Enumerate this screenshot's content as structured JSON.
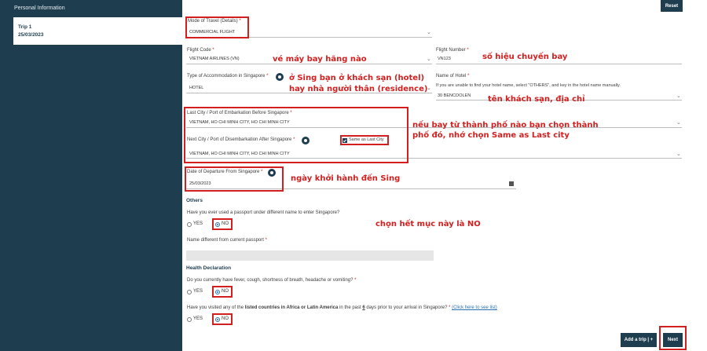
{
  "sidebar": {
    "header": "Personal Information",
    "trip_label": "Trip 1",
    "trip_date": "25/03/2023"
  },
  "toolbar": {
    "reset_label": "Reset"
  },
  "form": {
    "mode_of_travel": {
      "label": "Mode of Travel (Details)",
      "value": "COMMERCIAL FLIGHT"
    },
    "flight_code": {
      "label": "Flight Code",
      "value": "VIETNAM AIRLINES (VN)"
    },
    "flight_number": {
      "label": "Flight Number",
      "value": "VN123"
    },
    "accommodation_type": {
      "label": "Type of Accommodation in Singapore",
      "value": "HOTEL"
    },
    "hotel_name": {
      "label": "Name of Hotel",
      "help": "If you are unable to find your hotel name, select \"OTHERS\", and key in the hotel name manually.",
      "value": "30 BENCOOLEN"
    },
    "last_city": {
      "label": "Last City / Port of Embarkation Before Singapore",
      "value": "VIETNAM, HO CHI MINH CITY, HO CHI MINH CITY"
    },
    "next_city": {
      "label": "Next City / Port of Disembarkation After Singapore",
      "value": "VIETNAM, HO CHI MINH CITY, HO CHI MINH CITY",
      "same_as_label": "Same as Last City"
    },
    "departure_date": {
      "label": "Date of Departure From Singapore",
      "value": "25/03/2023"
    }
  },
  "others": {
    "title": "Others",
    "q_passport": "Have you ever used a passport under different name to enter Singapore?",
    "name_label": "Name different from current passport"
  },
  "health": {
    "title": "Health Declaration",
    "q_symptoms": "Do you currently have fever, cough, shortness of breath, headache or vomiting?",
    "q_visited_pre": "Have you visited any of the ",
    "q_visited_bold": "listed countries in Africa or Latin America",
    "q_visited_mid": " in the past ",
    "q_visited_days": "6",
    "q_visited_post": " days prior to your arrival in Singapore?",
    "link_label": "(Click here to see list)"
  },
  "radio": {
    "yes": "YES",
    "no": "NO"
  },
  "buttons": {
    "add_trip": "Add a trip | +",
    "next": "Next"
  },
  "annotations": {
    "flight_code_note": "vé máy bay hãng nào",
    "flight_number_note": "số hiệu chuyến bay",
    "accommodation_note_1": "ở Sing bạn ở khách sạn (hotel)",
    "accommodation_note_2": "hay nhà người thân (residence)",
    "hotel_note": "tên khách sạn, địa chỉ",
    "city_note_1": "nếu bay từ thành phố nào bạn chọn thành",
    "city_note_2": "phố đó, nhớ chọn Same as Last city",
    "departure_note": "ngày khởi hành đến Sing",
    "others_note": "chọn hết mục này là NO"
  },
  "colors": {
    "sidebar": "#1e3d4f",
    "highlight": "#d21f1f",
    "link": "#2a6fb0"
  }
}
